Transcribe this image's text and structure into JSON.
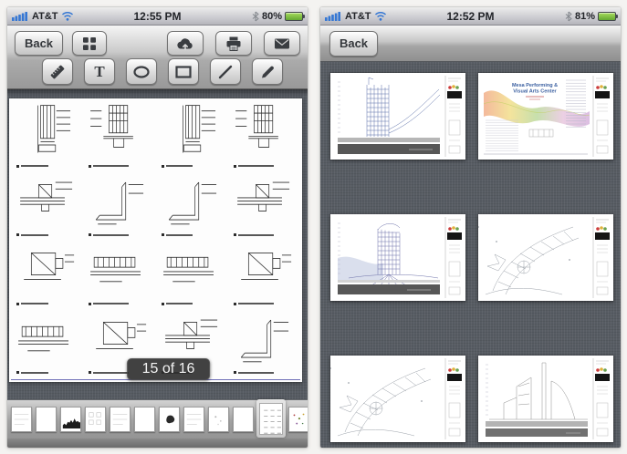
{
  "left_screen": {
    "status_bar": {
      "carrier": "AT&T",
      "time": "12:55 PM",
      "battery_percent": "80%",
      "icons": [
        "signal-strength-icon",
        "wifi-icon",
        "bluetooth-icon",
        "battery-icon"
      ]
    },
    "toolbar": {
      "back_label": "Back",
      "text_tool_label": "T",
      "buttons": [
        "back-button",
        "pages-grid-button",
        "cloud-upload-button",
        "print-button",
        "email-button"
      ],
      "tools": [
        "ruler-tool",
        "text-tool",
        "ellipse-tool",
        "rectangle-tool",
        "line-tool",
        "pencil-tool"
      ]
    },
    "page_indicator": "15 of 16",
    "document_page": {
      "description": "scanned architectural detail sheet, 4x4 grid of window/wall section details with tiny captions",
      "cells": [
        "jamb",
        "head",
        "jamb",
        "head",
        "sill",
        "corner",
        "corner",
        "sill",
        "plan",
        "wide",
        "wide",
        "plan",
        "wide",
        "plan",
        "sill",
        "corner"
      ]
    },
    "thumbnail_strip": {
      "items": [
        {
          "variant": "faint"
        },
        {
          "variant": "blank"
        },
        {
          "variant": "skyline"
        },
        {
          "variant": "grid"
        },
        {
          "variant": "faint"
        },
        {
          "variant": "blank"
        },
        {
          "variant": "blob"
        },
        {
          "variant": "faint"
        },
        {
          "variant": "dots"
        },
        {
          "variant": "blank"
        },
        {
          "variant": "selected",
          "selected": true
        },
        {
          "variant": "confetti"
        }
      ]
    }
  },
  "right_screen": {
    "status_bar": {
      "carrier": "AT&T",
      "time": "12:52 PM",
      "battery_percent": "81%",
      "icons": [
        "signal-strength-icon",
        "wifi-icon",
        "bluetooth-icon",
        "battery-icon"
      ]
    },
    "toolbar": {
      "back_label": "Back"
    },
    "sheets": [
      {
        "variant": "section",
        "name": "building-section-sheet"
      },
      {
        "variant": "title",
        "name": "title-sheet",
        "title_line1": "Mesa Performing &",
        "title_line2": "Visual Arts Center"
      },
      {
        "variant": "section2",
        "name": "building-section-sheet-2"
      },
      {
        "variant": "siteplan",
        "name": "site-plan-sheet"
      },
      {
        "variant": "siteplan",
        "name": "site-plan-sheet-2"
      },
      {
        "variant": "elevation",
        "name": "building-elevation-sheet"
      }
    ]
  },
  "colors": {
    "status_blue": "#3577d4",
    "battery_green": "#7cc243",
    "linen_gray": "#575c63",
    "drawing_blue": "#5b6fa8",
    "indicator_bg": "#2c2c2c"
  }
}
